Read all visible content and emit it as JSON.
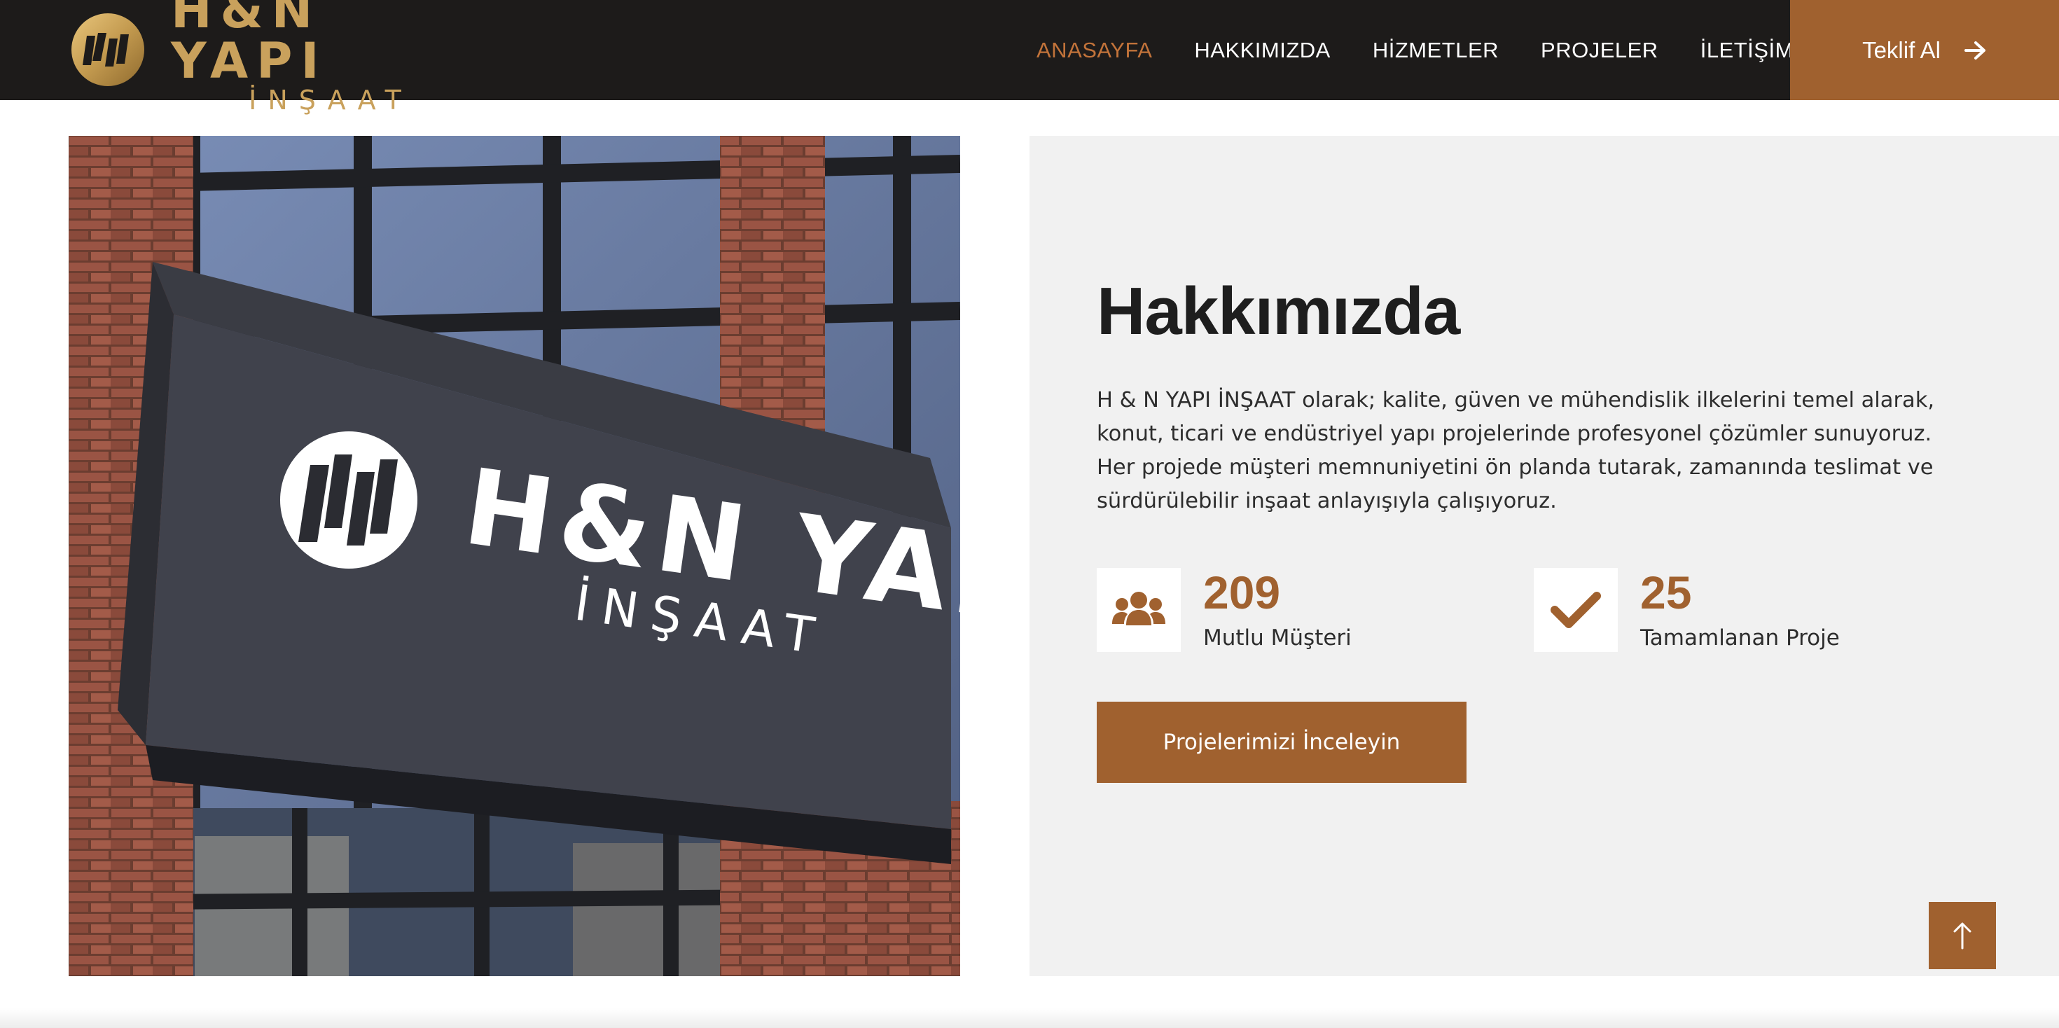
{
  "brand": {
    "name": "H&N YAPI",
    "subtitle": "İNŞAAT",
    "emblem_icon": "hn-monogram-icon",
    "gold_color": "#c9a15c"
  },
  "nav": {
    "items": [
      {
        "label": "ANASAYFA",
        "active": true
      },
      {
        "label": "HAKKIMIZDA",
        "active": false
      },
      {
        "label": "HİZMETLER",
        "active": false
      },
      {
        "label": "PROJELER",
        "active": false
      },
      {
        "label": "İLETİŞİM",
        "active": false
      }
    ],
    "cta_label": "Teklif Al",
    "cta_icon": "arrow-right-icon"
  },
  "photo": {
    "sign_name": "H&N YAPI",
    "sign_subtitle": "İNŞAAT"
  },
  "about": {
    "title": "Hakkımızda",
    "text": "H & N YAPI İNŞAAT olarak; kalite, güven ve mühendislik ilkelerini temel alarak, konut, ticari ve endüstriyel yapı projelerinde profesyonel çözümler sunuyoruz. Her projede müşteri memnuniyetini ön planda tutarak, zamanında teslimat ve sürdürülebilir inşaat anlayışıyla çalışıyoruz.",
    "stats": [
      {
        "value": "209",
        "label": "Mutlu Müşteri",
        "icon": "users-icon"
      },
      {
        "value": "25",
        "label": "Tamamlanan Proje",
        "icon": "checkmark-icon"
      }
    ],
    "button_label": "Projelerimizi İnceleyin"
  },
  "scroll_top_icon": "arrow-up-icon",
  "colors": {
    "accent": "#a0612f",
    "nav_active": "#c2733a",
    "navbar_bg": "#1d1b1a",
    "panel_bg": "#f1f1f1"
  }
}
